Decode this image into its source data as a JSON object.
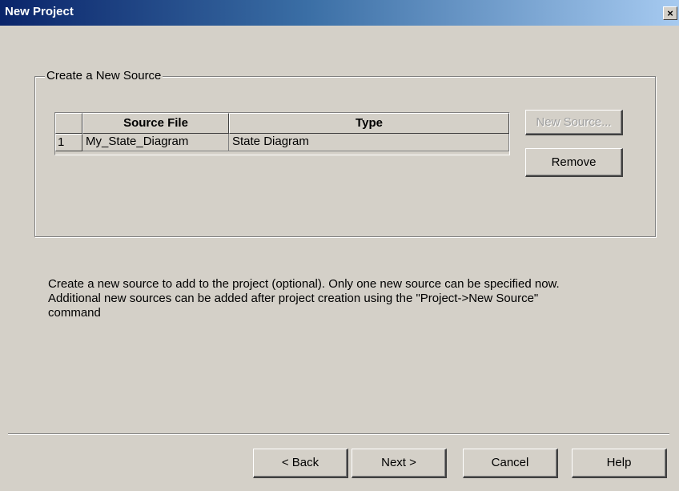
{
  "window": {
    "title": "New Project",
    "close_glyph": "×"
  },
  "group": {
    "legend": "Create a New Source"
  },
  "grid": {
    "columns": [
      "",
      "Source File",
      "Type"
    ],
    "rows": [
      {
        "index": "1",
        "source_file": "My_State_Diagram",
        "type": "State Diagram"
      }
    ]
  },
  "buttons": {
    "new_source": "New Source...",
    "remove": "Remove",
    "back": "< Back",
    "next": "Next >",
    "cancel": "Cancel",
    "help": "Help"
  },
  "description": {
    "line1": "Create a new source to add to the project (optional). Only one new source can be specified now.",
    "line2": "Additional new sources can be added after project creation using the \"Project->New Source\"",
    "line3": "command"
  },
  "colors": {
    "dialog_bg": "#d4d0c8",
    "titlebar_start": "#0a246a",
    "titlebar_end": "#a6caf0"
  }
}
